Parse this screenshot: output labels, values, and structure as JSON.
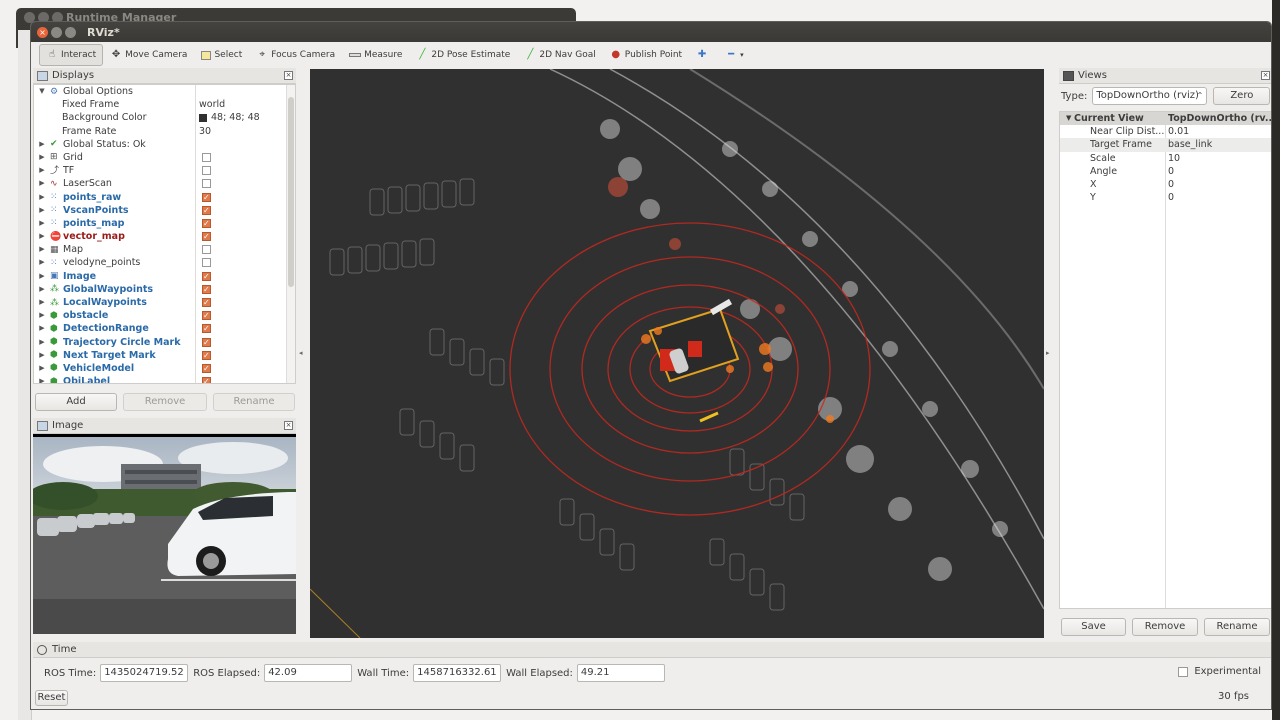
{
  "background_window": {
    "title": "Runtime Manager"
  },
  "window": {
    "title": "RViz*"
  },
  "toolbar": {
    "tools": [
      {
        "label": "Interact",
        "icon": "hand-icon"
      },
      {
        "label": "Move Camera",
        "icon": "move-camera-icon"
      },
      {
        "label": "Select",
        "icon": "select-icon"
      },
      {
        "label": "Focus Camera",
        "icon": "focus-camera-icon"
      },
      {
        "label": "Measure",
        "icon": "measure-icon"
      },
      {
        "label": "2D Pose Estimate",
        "icon": "pose-estimate-icon"
      },
      {
        "label": "2D Nav Goal",
        "icon": "nav-goal-icon"
      },
      {
        "label": "Publish Point",
        "icon": "publish-point-icon"
      }
    ]
  },
  "displays": {
    "title": "Displays",
    "items": [
      {
        "label": "Global Options",
        "value": "",
        "indent": 0,
        "style": "normal",
        "check": null
      },
      {
        "label": "Fixed Frame",
        "value": "world",
        "indent": 1,
        "style": "normal",
        "check": null
      },
      {
        "label": "Background Color",
        "value": "48; 48; 48",
        "indent": 1,
        "style": "normal",
        "check": null
      },
      {
        "label": "Frame Rate",
        "value": "30",
        "indent": 1,
        "style": "normal",
        "check": null
      },
      {
        "label": "Global Status: Ok",
        "value": "",
        "indent": 0,
        "style": "normal",
        "check": null
      },
      {
        "label": "Grid",
        "value": "",
        "indent": 0,
        "style": "normal",
        "check": false
      },
      {
        "label": "TF",
        "value": "",
        "indent": 0,
        "style": "normal",
        "check": false
      },
      {
        "label": "LaserScan",
        "value": "",
        "indent": 0,
        "style": "normal",
        "check": false
      },
      {
        "label": "points_raw",
        "value": "",
        "indent": 0,
        "style": "blue",
        "check": true
      },
      {
        "label": "VscanPoints",
        "value": "",
        "indent": 0,
        "style": "blue",
        "check": true
      },
      {
        "label": "points_map",
        "value": "",
        "indent": 0,
        "style": "blue",
        "check": true
      },
      {
        "label": "vector_map",
        "value": "",
        "indent": 0,
        "style": "red",
        "check": true
      },
      {
        "label": "Map",
        "value": "",
        "indent": 0,
        "style": "normal",
        "check": false
      },
      {
        "label": "velodyne_points",
        "value": "",
        "indent": 0,
        "style": "normal",
        "check": false
      },
      {
        "label": "Image",
        "value": "",
        "indent": 0,
        "style": "blue",
        "check": true
      },
      {
        "label": "GlobalWaypoints",
        "value": "",
        "indent": 0,
        "style": "blue",
        "check": true
      },
      {
        "label": "LocalWaypoints",
        "value": "",
        "indent": 0,
        "style": "blue",
        "check": true
      },
      {
        "label": "obstacle",
        "value": "",
        "indent": 0,
        "style": "blue",
        "check": true
      },
      {
        "label": "DetectionRange",
        "value": "",
        "indent": 0,
        "style": "blue",
        "check": true
      },
      {
        "label": "Trajectory Circle Mark",
        "value": "",
        "indent": 0,
        "style": "blue",
        "check": true
      },
      {
        "label": "Next Target Mark",
        "value": "",
        "indent": 0,
        "style": "blue",
        "check": true
      },
      {
        "label": "VehicleModel",
        "value": "",
        "indent": 0,
        "style": "blue",
        "check": true
      },
      {
        "label": "ObjLabel",
        "value": "",
        "indent": 0,
        "style": "blue",
        "check": true
      }
    ],
    "buttons": {
      "add": "Add",
      "remove": "Remove",
      "rename": "Rename"
    }
  },
  "image_panel": {
    "title": "Image"
  },
  "views": {
    "title": "Views",
    "type_label": "Type:",
    "type_value": "TopDownOrtho (rviz)",
    "zero_button": "Zero",
    "header": {
      "key": "Current View",
      "value": "TopDownOrtho (rv..."
    },
    "props": [
      {
        "key": "Near Clip Dist...",
        "value": "0.01"
      },
      {
        "key": "Target Frame",
        "value": "base_link"
      },
      {
        "key": "Scale",
        "value": "10"
      },
      {
        "key": "Angle",
        "value": "0"
      },
      {
        "key": "X",
        "value": "0"
      },
      {
        "key": "Y",
        "value": "0"
      }
    ],
    "buttons": {
      "save": "Save",
      "remove": "Remove",
      "rename": "Rename"
    }
  },
  "time_panel": {
    "title": "Time",
    "ros_time_label": "ROS Time:",
    "ros_time": "1435024719.52",
    "ros_elapsed_label": "ROS Elapsed:",
    "ros_elapsed": "42.09",
    "wall_time_label": "Wall Time:",
    "wall_time": "1458716332.61",
    "wall_elapsed_label": "Wall Elapsed:",
    "wall_elapsed": "49.21",
    "experimental_label": "Experimental",
    "reset_label": "Reset",
    "fps": "30 fps"
  },
  "colors": {
    "viewport_bg": "#303030",
    "accent_blue": "#2a6aa8",
    "accent_red": "#9b1a1a",
    "check_on": "#e07a4a"
  }
}
